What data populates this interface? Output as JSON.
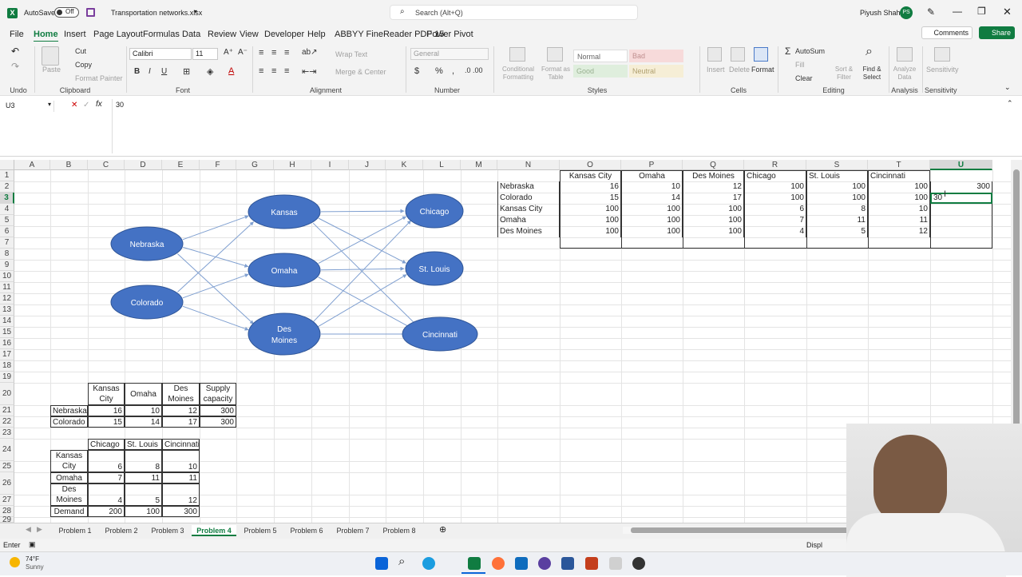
{
  "titlebar": {
    "app_icon": "excel-icon",
    "autosave_label": "AutoSave",
    "autosave_state": "Off",
    "save_icon": "save-icon",
    "filename": "Transportation networks.xlsx",
    "search_placeholder": "Search (Alt+Q)",
    "user_name": "Piyush Shah",
    "user_initials": "PS"
  },
  "menu": {
    "items": [
      "File",
      "Home",
      "Insert",
      "Page Layout",
      "Formulas",
      "Data",
      "Review",
      "View",
      "Developer",
      "Help",
      "ABBYY FineReader PDF 15",
      "Power Pivot"
    ],
    "active": "Home",
    "comments": "Comments",
    "share": "Share"
  },
  "ribbon": {
    "undo_group": "Undo",
    "clipboard": {
      "paste": "Paste",
      "cut": "Cut",
      "copy": "Copy",
      "format_painter": "Format Painter",
      "group": "Clipboard"
    },
    "font": {
      "name": "Calibri",
      "size": "11",
      "group": "Font",
      "bold": "B",
      "italic": "I",
      "underline": "U"
    },
    "alignment": {
      "wrap": "Wrap Text",
      "merge": "Merge & Center",
      "group": "Alignment"
    },
    "number": {
      "format": "General",
      "group": "Number"
    },
    "styles": {
      "conditional": "Conditional Formatting",
      "format_table": "Format as Table",
      "normal": "Normal",
      "bad": "Bad",
      "good": "Good",
      "neutral": "Neutral",
      "group": "Styles"
    },
    "cells": {
      "insert": "Insert",
      "delete": "Delete",
      "format": "Format",
      "group": "Cells"
    },
    "editing": {
      "autosum": "AutoSum",
      "fill": "Fill",
      "clear": "Clear",
      "sort": "Sort & Filter",
      "find": "Find & Select",
      "group": "Editing"
    },
    "analysis": {
      "analyze": "Analyze Data",
      "group": "Analysis"
    },
    "sensitivity": {
      "label": "Sensitivity",
      "group": "Sensitivity"
    }
  },
  "formula_bar": {
    "name_box": "U3",
    "fx": "fx",
    "content": "30"
  },
  "columns": [
    "A",
    "B",
    "C",
    "D",
    "E",
    "F",
    "G",
    "H",
    "I",
    "J",
    "K",
    "L",
    "M",
    "N",
    "O",
    "P",
    "Q",
    "R",
    "S",
    "T",
    "U"
  ],
  "rows": [
    "1",
    "2",
    "3",
    "4",
    "5",
    "6",
    "7",
    "8",
    "9",
    "10",
    "11",
    "12",
    "13",
    "14",
    "15",
    "16",
    "17",
    "18",
    "19",
    "20",
    "21",
    "22",
    "23",
    "24",
    "25",
    "26",
    "27",
    "28",
    "29"
  ],
  "diagram": {
    "sources": [
      "Nebraska",
      "Colorado"
    ],
    "transshipment": [
      "Kansas",
      "Omaha",
      "Des Moines"
    ],
    "destinations": [
      "Chicago",
      "St. Louis",
      "Cincinnati"
    ],
    "node_color": "#4472c4",
    "edge_color": "#7f9fd0"
  },
  "supply_table": {
    "headers": [
      "Kansas City",
      "Omaha",
      "Des Moines",
      "Supply capacity"
    ],
    "rows": [
      {
        "name": "Nebraska",
        "values": [
          "16",
          "10",
          "12",
          "300"
        ]
      },
      {
        "name": "Colorado",
        "values": [
          "15",
          "14",
          "17",
          "300"
        ]
      }
    ]
  },
  "demand_table": {
    "headers": [
      "Chicago",
      "St. Louis",
      "Cincinnati"
    ],
    "rows": [
      {
        "name": "Kansas City",
        "values": [
          "6",
          "8",
          "10"
        ]
      },
      {
        "name": "Omaha",
        "values": [
          "7",
          "11",
          "11"
        ]
      },
      {
        "name": "Des Moines",
        "values": [
          "4",
          "5",
          "12"
        ]
      },
      {
        "name": "Demand",
        "values": [
          "200",
          "100",
          "300"
        ]
      }
    ]
  },
  "matrix": {
    "headers": [
      "Kansas City",
      "Omaha",
      "Des Moines",
      "Chicago",
      "St. Louis",
      "Cincinnati"
    ],
    "rows": [
      {
        "name": "Nebraska",
        "values": [
          "16",
          "10",
          "12",
          "100",
          "100",
          "100"
        ],
        "extra": "300"
      },
      {
        "name": "Colorado",
        "values": [
          "15",
          "14",
          "17",
          "100",
          "100",
          "100"
        ],
        "extra": "30"
      },
      {
        "name": "Kansas City",
        "values": [
          "100",
          "100",
          "100",
          "6",
          "8",
          "10"
        ],
        "extra": ""
      },
      {
        "name": "Omaha",
        "values": [
          "100",
          "100",
          "100",
          "7",
          "11",
          "11"
        ],
        "extra": ""
      },
      {
        "name": "Des Moines",
        "values": [
          "100",
          "100",
          "100",
          "4",
          "5",
          "12"
        ],
        "extra": ""
      }
    ]
  },
  "sheets": [
    "Problem 1",
    "Problem 2",
    "Problem 3",
    "Problem 4",
    "Problem 5",
    "Problem 6",
    "Problem 7",
    "Problem 8"
  ],
  "active_sheet": "Problem 4",
  "status": {
    "mode": "Enter",
    "display": "Displ"
  },
  "weather": {
    "temp": "74°F",
    "condition": "Sunny"
  },
  "accent": "#107c41"
}
